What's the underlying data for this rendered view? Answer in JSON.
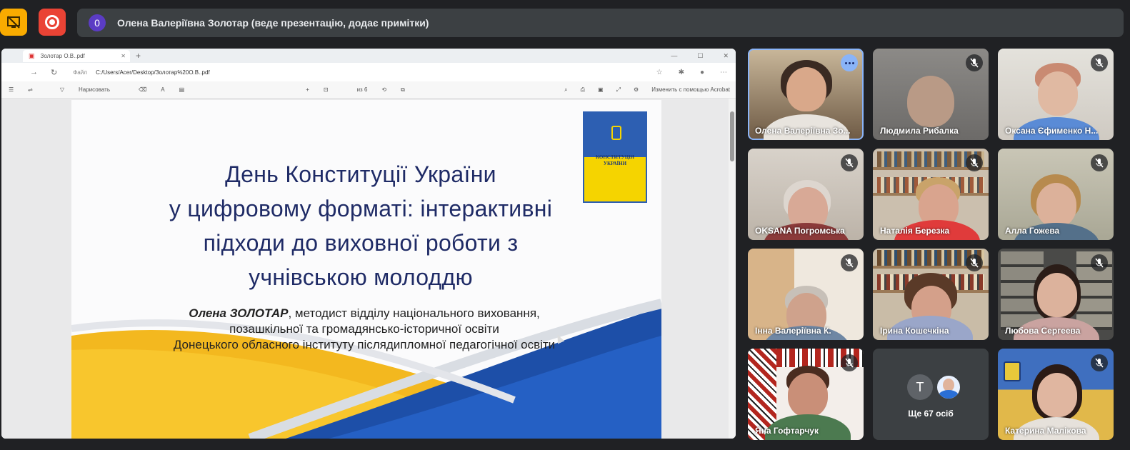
{
  "topbar": {
    "present_icon": "no-presentation-icon",
    "record_icon": "recording-icon",
    "info_badge": "0",
    "presenter_status": "Олена Валеріївна Золотар (веде презентацію, додає примітки)"
  },
  "browser": {
    "tab_title": "Золотар О.В..pdf",
    "url_label": "Файл",
    "url": "C:/Users/Acer/Desktop/Золотар%20О.В..pdf",
    "pdf_toolbar": {
      "draw_label": "Нарисовать",
      "page_value": "из 6",
      "ask_label": "Изменить с помощью Acrobat"
    }
  },
  "slide": {
    "book_title": "КОНСТИТУЦІЯ УКРАЇНИ",
    "title_line1": "День Конституції України",
    "title_line2": "у цифровому форматі: інтерактивні",
    "title_line3": "підходи до виховної роботи з",
    "title_line4": "учнівською молоддю",
    "author_name": "Олена ЗОЛОТАР",
    "author_role": ", методист відділу національного виховання,",
    "author_line2": "позашкільної та громадянсько-історичної освіти",
    "author_line3": "Донецького обласного інституту післядипломної педагогічної освіти"
  },
  "participants": [
    {
      "name": "Олена Валеріївна Зо...",
      "muted": false
    },
    {
      "name": "Людмила Рибалка",
      "muted": true
    },
    {
      "name": "Оксана Єфименко Н...",
      "muted": true
    },
    {
      "name": "OKSANA Погромська",
      "muted": true
    },
    {
      "name": "Наталія Березка",
      "muted": true
    },
    {
      "name": "Алла Гожева",
      "muted": true
    },
    {
      "name": "Інна Валеріївна К.",
      "muted": true
    },
    {
      "name": "Ірина Кошечкіна",
      "muted": true
    },
    {
      "name": "Любова Сергеева",
      "muted": true
    },
    {
      "name": "Яна Гофтарчук",
      "muted": true
    },
    {
      "name": "Катерина Малікова",
      "muted": true
    }
  ],
  "more": {
    "avatar_letter": "T",
    "label": "Ще 67 осіб"
  },
  "colors": {
    "present_button": "#f9ab00",
    "record_button": "#ea4335",
    "badge": "#5b3cc4",
    "slide_title": "#1f2b66",
    "flag_blue": "#2d5fb2",
    "flag_yellow": "#f5d400"
  }
}
